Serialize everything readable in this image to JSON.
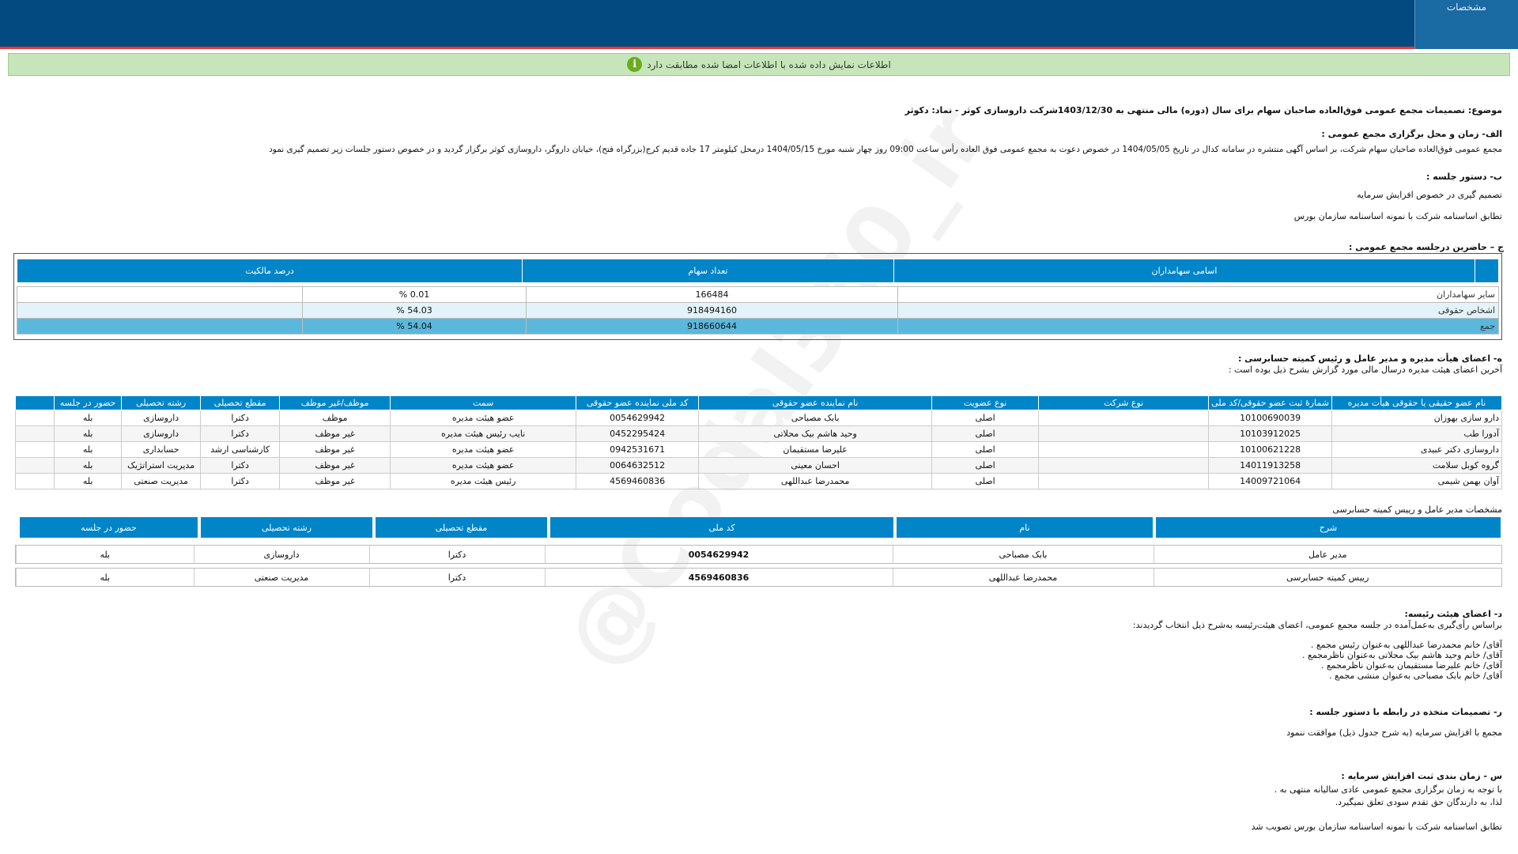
{
  "header": {
    "tab_label": "مشخصات"
  },
  "alert": {
    "text": "اطلاعات نمایش داده شده با اطلاعات امضا شده مطابقت دارد",
    "icon": "info-icon",
    "icon_glyph": "i"
  },
  "subject": "موضوع: تصمیمات مجمع عمومی فوق‌العاده صاحبان سهام برای سال (دوره) مالی منتهی به 1403/12/30شرکت داروسازی کوثر - نماد: دکوثر",
  "section_alef": {
    "title": "الف- زمان و محل برگزاری مجمع عمومی :",
    "text": "مجمع عمومی فوق‌العاده صاحبان سهام شرکت، بر اساس آگهی منتشره در سامانه کدال در تاریخ 1404/05/05 در خصوص دعوت به مجمع عمومی فوق العاده رأس ساعت 09:00 روز چهار شنبه مورخ 1404/05/15 درمحل کیلومتر 17 جاده قدیم کرج(بزرگراه فتح)، خیابان داروگر، داروسازی کوثر    برگزار گردید و در خصوص دستور جلسات زیر تصمیم گیری نمود"
  },
  "section_be": {
    "title": "ب- دستور جلسه :",
    "items": [
      "تصمیم گیری در خصوص افزایش سرمایه",
      "تطابق اساسنامه شرکت با نمونه اساسنامه سازمان بورس"
    ]
  },
  "section_jim": {
    "title": "ج – حاضرین درجلسه مجمع عمومی :",
    "headers": [
      "اسامی سهامداران",
      "تعداد سهام",
      "درصد مالکیت"
    ],
    "rows": [
      [
        "سایر سهامداران",
        "166484",
        "0.01 %"
      ],
      [
        "اشخاص حقوقی",
        "918494160",
        "54.03 %"
      ],
      [
        "جمع",
        "918660644",
        "54.04 %"
      ]
    ]
  },
  "section_he": {
    "title": "ه- اعضای هیأت مدیره و مدیر عامل و رئیس کمیته حسابرسی :",
    "subtitle": "آخرین اعضای هیئت مدیره درسال مالی مورد گزارش بشرح ذیل بوده است :",
    "headers": [
      "نام عضو حقیقی یا حقوقی هیأت مدیره",
      "شمارهٔ ثبت عضو حقوقی/کد ملی",
      "نوع شرکت",
      "نوع عضویت",
      "نام نماینده عضو حقوقی",
      "کد ملی نماینده عضو حقوقی",
      "سمت",
      "موظف/غیر موظف",
      "مقطع تحصیلی",
      "رشته تحصیلی",
      "حضور در جلسه"
    ],
    "rows": [
      [
        "دارو سازی بهوزان",
        "10100690039",
        "",
        "اصلی",
        "بابک مصباحی",
        "0054629942",
        "عضو هیئت مدیره",
        "موظف",
        "دکترا",
        "داروسازی",
        "بله"
      ],
      [
        "آدورا طب",
        "10103912025",
        "",
        "اصلی",
        "وحید هاشم بیک محلاتی",
        "0452295424",
        "نایب رئیس هیئت مدیره",
        "غیر موظف",
        "دکترا",
        "داروسازی",
        "بله"
      ],
      [
        "داروسازی دکتر عبیدی",
        "10100621228",
        "",
        "اصلی",
        "علیرضا مستقیمان",
        "0942531671",
        "عضو هیئت مدیره",
        "غیر موظف",
        "کارشناسی ارشد",
        "حسابداری",
        "بله"
      ],
      [
        "گروه کوبل سلامت",
        "14011913258",
        "",
        "اصلی",
        "احسان معینی",
        "0064632512",
        "عضو هیئت مدیره",
        "غیر موظف",
        "دکترا",
        "مدیریت استراتژیک",
        "بله"
      ],
      [
        "آوان بهمن شیمی",
        "14009721064",
        "",
        "اصلی",
        "محمدرضا عبداللهی",
        "4569460836",
        "رئیس هیئت مدیره",
        "غیر موظف",
        "دکترا",
        "مدیریت صنعتی",
        "بله"
      ]
    ]
  },
  "ceo": {
    "title": "مشخصات مدیر عامل و رییس کمیته حسابرسی",
    "headers": [
      "شرح",
      "نام",
      "کد ملی",
      "مقطع تحصیلی",
      "رشته تحصیلی",
      "حضور در جلسه"
    ],
    "rows": [
      [
        "مدیر عامل",
        "بابک مصباحی",
        "0054629942",
        "دکترا",
        "داروسازی",
        "بله"
      ],
      [
        "رییس کمیته حسابرسی",
        "محمدرضا عبداللهی",
        "4569460836",
        "دکترا",
        "مدیریت صنعتی",
        "بله"
      ]
    ]
  },
  "section_dal": {
    "title": "د- اعضای هیئت رئیسه:",
    "intro": "براساس رأی‌گیری به‌عمل‌آمده در جلسه مجمع عمومی، اعضای هیئت‌رئیسه به‌شرح ذیل انتخاب گردیدند:",
    "lines": [
      "آقای/ خانم   محمدرضا عبداللهی   به‌عنوان رئیس مجمع .",
      "آقای/ خانم   وحید هاشم بیک محلاتی   به‌عنوان ناظرمجمع .",
      "آقای/ خانم   علیرضا مستقیمان   به‌عنوان ناظرمجمع .",
      "آقای/ خانم   بابک مصباحی   به‌عنوان منشی مجمع ."
    ]
  },
  "section_re": {
    "title": "ر- تصمیمات متخذه در رابطه با دستور جلسه :",
    "text": "مجمع با افزایش سرمایه (به شرح جدول ذیل) موافقت ننمود"
  },
  "section_sin": {
    "title": "س - زمان بندی ثبت افزایش سرمایه :",
    "line1": "با توجه به زمان برگزاری مجمع عمومی عادی سالیانه منتهی به                      .",
    "line2": "لذا، به دارندگان حق تقدم سودی تعلق نمیگیرد.",
    "line3": "تطابق اساسنامه شرکت با نمونه اساسنامه سازمان بورس تصویب شد"
  },
  "watermark": "@Codal360_ir"
}
